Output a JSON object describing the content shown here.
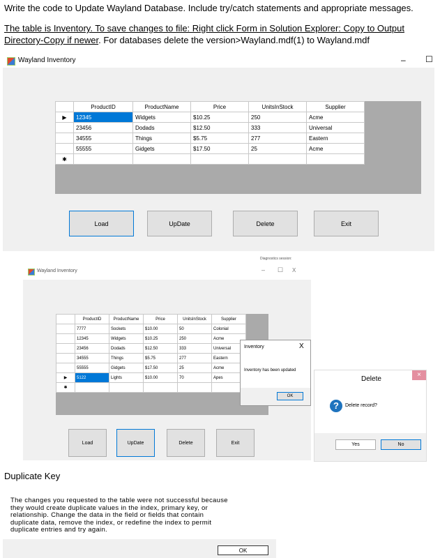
{
  "intro": {
    "line1": "Write the code to Update Wayland Database. Include try/catch statements and appropriate messages.",
    "line2a": "The table is Inventory. To save changes to file: Right click Form in Solution Explorer: Copy to Output",
    "line2b": "Directory-Copy if newer",
    "line2c": ". For databases delete the version>Wayland.mdf(1) to Wayland.mdf"
  },
  "form1": {
    "title": "Wayland Inventory",
    "minimize": "–",
    "maximize": "☐",
    "columns": [
      "ProductID",
      "ProductName",
      "Price",
      "UnitsInStock",
      "Supplier"
    ],
    "rows": [
      [
        "12345",
        "Widgets",
        "$10.25",
        "250",
        "Acme"
      ],
      [
        "23456",
        "Dodads",
        "$12.50",
        "333",
        "Universal"
      ],
      [
        "34555",
        "Things",
        "$5.75",
        "277",
        "Eastern"
      ],
      [
        "55555",
        "Gidgets",
        "$17.50",
        "25",
        "Acme"
      ]
    ],
    "current_marker": "▶",
    "new_marker": "✱",
    "buttons": {
      "load": "Load",
      "update": "UpDate",
      "delete": "Delete",
      "exit": "Exit"
    }
  },
  "form2": {
    "title": "Wayland Inventory",
    "partial_label": "Diagnostics session:",
    "minimize": "–",
    "maximize": "☐",
    "close": "X",
    "columns": [
      "ProductID",
      "ProductName",
      "Price",
      "UnitsInStock",
      "Supplier"
    ],
    "rows": [
      [
        "7777",
        "Sockets",
        "$10.00",
        "50",
        "Colonial"
      ],
      [
        "12345",
        "Widgets",
        "$10.25",
        "250",
        "Acme"
      ],
      [
        "23456",
        "Dodads",
        "$12.50",
        "333",
        "Universal"
      ],
      [
        "34555",
        "Things",
        "$5.75",
        "277",
        "Eastern"
      ],
      [
        "55555",
        "Gidgets",
        "$17.50",
        "25",
        "Acme"
      ],
      [
        "5122",
        "Lights",
        "$10.00",
        "70",
        "Apes"
      ]
    ],
    "buttons": {
      "load": "Load",
      "update": "UpDate",
      "delete": "Delete",
      "exit": "Exit"
    }
  },
  "msgbox": {
    "title": "Inventory",
    "close": "X",
    "message": "Inventory has been updated",
    "ok": "OK"
  },
  "delete_dialog": {
    "title": "Delete",
    "close": "×",
    "icon": "?",
    "message": "Delete record?",
    "yes": "Yes",
    "no": "No"
  },
  "duplicate": {
    "heading": "Duplicate Key",
    "lines": [
      "The changes you requested to the table were not successful because",
      "they would create duplicate values in the index, primary key, or",
      "relationship. Change the data in the field or fields that contain",
      "duplicate data, remove the index, or redefine the index to permit",
      "duplicate entries and try again."
    ],
    "ok": "OK"
  },
  "colors": {
    "selection": "#0078d7",
    "grid_background": "#aaaaaa",
    "form_background": "#f0f0f0",
    "question_icon": "#1e73be"
  }
}
